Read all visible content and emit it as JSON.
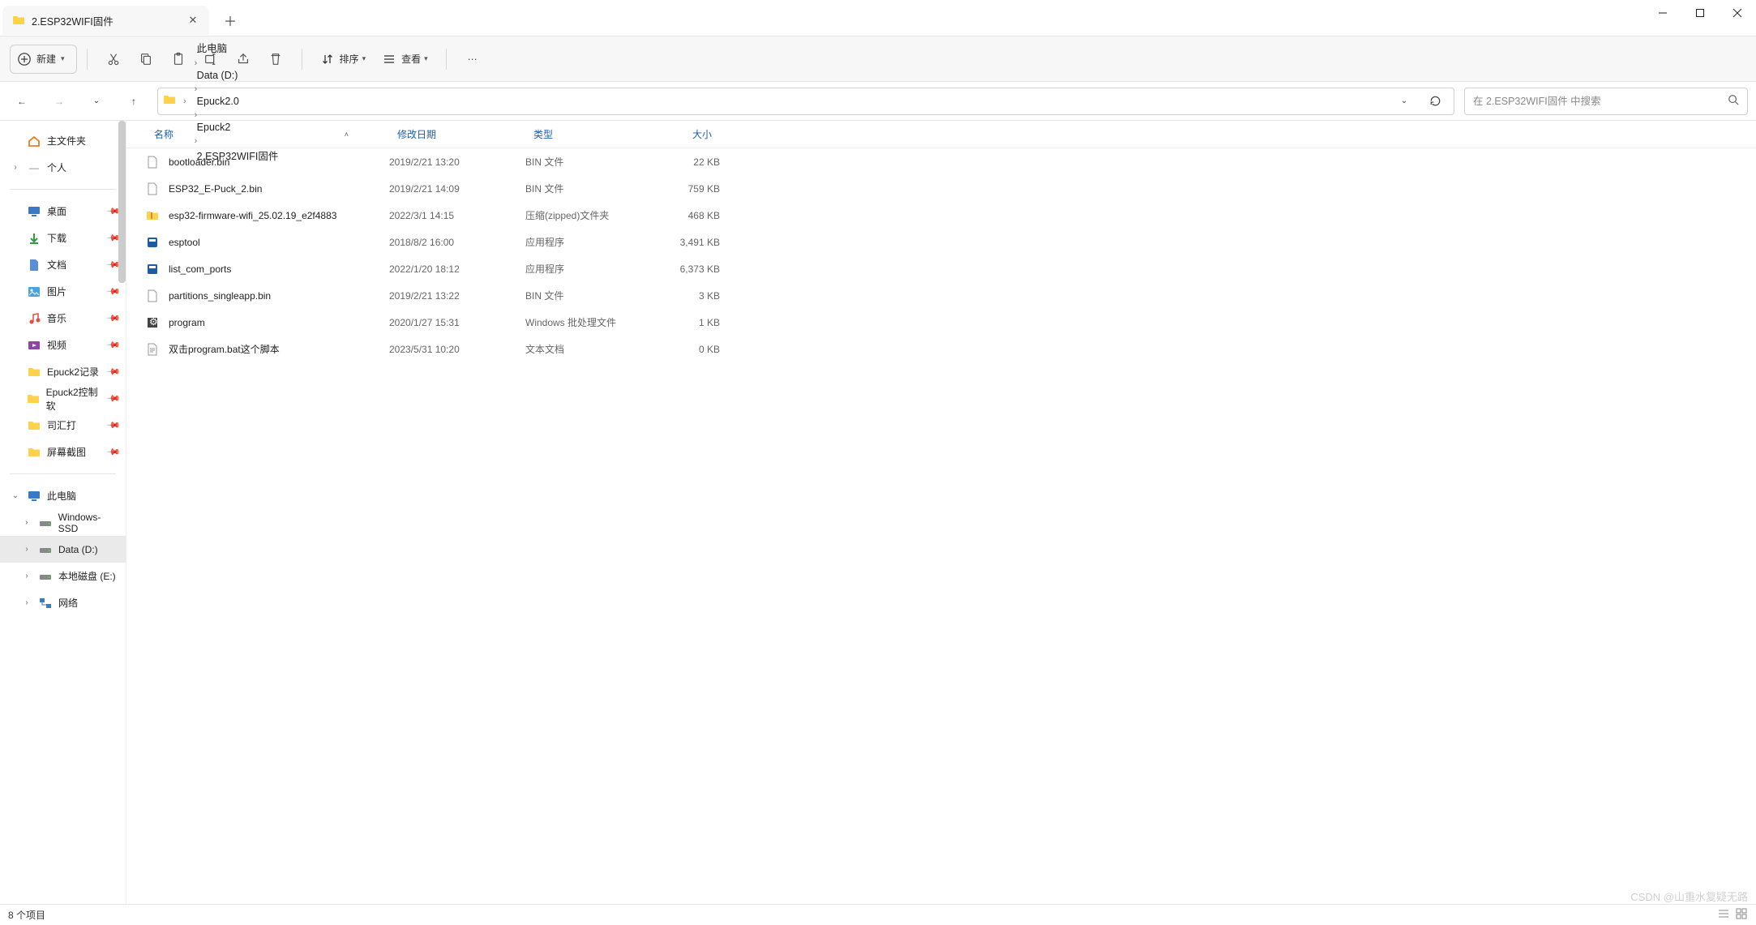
{
  "window": {
    "tab_title": "2.ESP32WIFI固件"
  },
  "toolbar": {
    "new_label": "新建",
    "sort_label": "排序",
    "view_label": "查看"
  },
  "breadcrumbs": [
    "此电脑",
    "Data (D:)",
    "Epuck2.0",
    "Epuck2",
    "2.ESP32WIFI固件"
  ],
  "search": {
    "placeholder": "在 2.ESP32WIFI固件 中搜索"
  },
  "sidebar": {
    "home": "主文件夹",
    "personal": "个人",
    "quick": [
      {
        "label": "桌面",
        "icon": "desktop"
      },
      {
        "label": "下载",
        "icon": "download"
      },
      {
        "label": "文档",
        "icon": "document"
      },
      {
        "label": "图片",
        "icon": "picture"
      },
      {
        "label": "音乐",
        "icon": "music"
      },
      {
        "label": "视频",
        "icon": "video"
      },
      {
        "label": "Epuck2记录",
        "icon": "folder"
      },
      {
        "label": "Epuck2控制软",
        "icon": "folder"
      },
      {
        "label": "司汇打",
        "icon": "folder"
      },
      {
        "label": "屏幕截图",
        "icon": "folder"
      }
    ],
    "thispc": "此电脑",
    "drives": [
      {
        "label": "Windows-SSD"
      },
      {
        "label": "Data (D:)"
      },
      {
        "label": "本地磁盘 (E:)"
      }
    ],
    "network": "网络"
  },
  "columns": {
    "name": "名称",
    "date": "修改日期",
    "type": "类型",
    "size": "大小"
  },
  "files": [
    {
      "name": "bootloader.bin",
      "date": "2019/2/21 13:20",
      "type": "BIN 文件",
      "size": "22 KB",
      "icon": "file"
    },
    {
      "name": "ESP32_E-Puck_2.bin",
      "date": "2019/2/21 14:09",
      "type": "BIN 文件",
      "size": "759 KB",
      "icon": "file"
    },
    {
      "name": "esp32-firmware-wifi_25.02.19_e2f4883",
      "date": "2022/3/1 14:15",
      "type": "压缩(zipped)文件夹",
      "size": "468 KB",
      "icon": "zip"
    },
    {
      "name": "esptool",
      "date": "2018/8/2 16:00",
      "type": "应用程序",
      "size": "3,491 KB",
      "icon": "exe"
    },
    {
      "name": "list_com_ports",
      "date": "2022/1/20 18:12",
      "type": "应用程序",
      "size": "6,373 KB",
      "icon": "exe"
    },
    {
      "name": "partitions_singleapp.bin",
      "date": "2019/2/21 13:22",
      "type": "BIN 文件",
      "size": "3 KB",
      "icon": "file"
    },
    {
      "name": "program",
      "date": "2020/1/27 15:31",
      "type": "Windows 批处理文件",
      "size": "1 KB",
      "icon": "bat"
    },
    {
      "name": "双击program.bat这个脚本",
      "date": "2023/5/31 10:20",
      "type": "文本文档",
      "size": "0 KB",
      "icon": "txt"
    }
  ],
  "status": {
    "text": "8 个项目"
  },
  "watermark": "CSDN @山重水复疑无路"
}
